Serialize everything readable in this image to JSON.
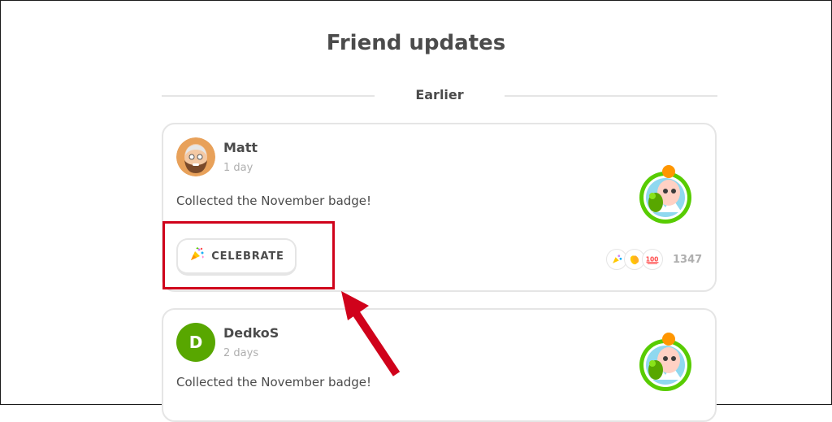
{
  "page": {
    "title": "Friend updates",
    "section_label": "Earlier"
  },
  "feed": [
    {
      "user": "Matt",
      "time": "1 day",
      "text": "Collected the November badge!",
      "avatar_type": "illustrated-bearded-man",
      "celebrate_label": "CELEBRATE",
      "reactions": [
        "party-popper-icon",
        "clapping-hands-icon",
        "hundred-points-icon"
      ],
      "reaction_count": "1347"
    },
    {
      "user": "DedkoS",
      "time": "2 days",
      "text": "Collected the November badge!",
      "avatar_letter": "D",
      "avatar_color": "#58a700"
    }
  ],
  "colors": {
    "highlight": "#d0021b",
    "arrow": "#d0021b",
    "border": "#e5e5e5",
    "muted_text": "#afafaf"
  }
}
